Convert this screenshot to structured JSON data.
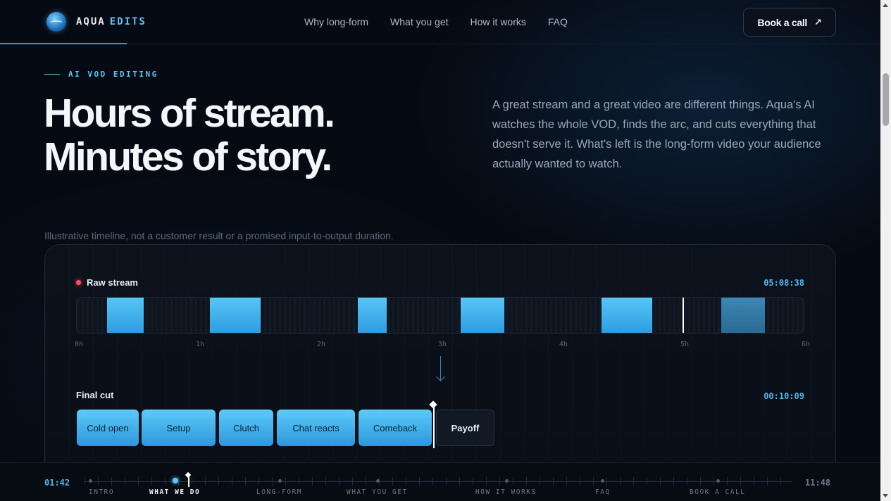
{
  "header": {
    "brand_first": "AQUA",
    "brand_second": "EDITS",
    "nav": [
      "Why long-form",
      "What you get",
      "How it works",
      "FAQ"
    ],
    "cta_label": "Book a call",
    "cta_icon": "arrow-up-right-icon"
  },
  "hero": {
    "eyebrow": "AI VOD EDITING",
    "headline_line1": "Hours of stream.",
    "headline_line2": "Minutes of story.",
    "intro": "A great stream and a great video are different things. Aqua's AI watches the whole VOD, finds the arc, and cuts everything that doesn't serve it. What's left is the long-form video your audience actually wanted to watch."
  },
  "timeline": {
    "disclaimer": "Illustrative timeline, not a customer result or a promised input-to-output duration.",
    "raw_label": "Raw stream",
    "raw_time": "05:08:38",
    "hour_ticks": [
      "0h",
      "1h",
      "2h",
      "3h",
      "4h",
      "5h",
      "6h"
    ],
    "raw_hours_total": 6,
    "playhead_hour": 5.0,
    "raw_segments_hours": [
      {
        "start": 0.25,
        "end": 0.55,
        "dim": false
      },
      {
        "start": 1.1,
        "end": 1.52,
        "dim": false
      },
      {
        "start": 2.32,
        "end": 2.56,
        "dim": false
      },
      {
        "start": 3.17,
        "end": 3.53,
        "dim": false
      },
      {
        "start": 4.33,
        "end": 4.75,
        "dim": false
      },
      {
        "start": 5.32,
        "end": 5.68,
        "dim": true
      }
    ],
    "final_label": "Final cut",
    "final_time": "00:10:09",
    "clips": [
      "Cold open",
      "Setup",
      "Clutch",
      "Chat reacts",
      "Comeback",
      "Payoff"
    ]
  },
  "scrubber": {
    "current_time": "01:42",
    "total_time": "11:48",
    "chapters": [
      "INTRO",
      "WHAT WE DO",
      "LONG-FORM",
      "WHAT YOU GET",
      "HOW IT WORKS",
      "FAQ",
      "BOOK A CALL"
    ],
    "active_chapter": "WHAT WE DO"
  },
  "colors": {
    "accent": "#5fc4f5",
    "background": "#060a12",
    "recording": "#ff4d5e"
  }
}
